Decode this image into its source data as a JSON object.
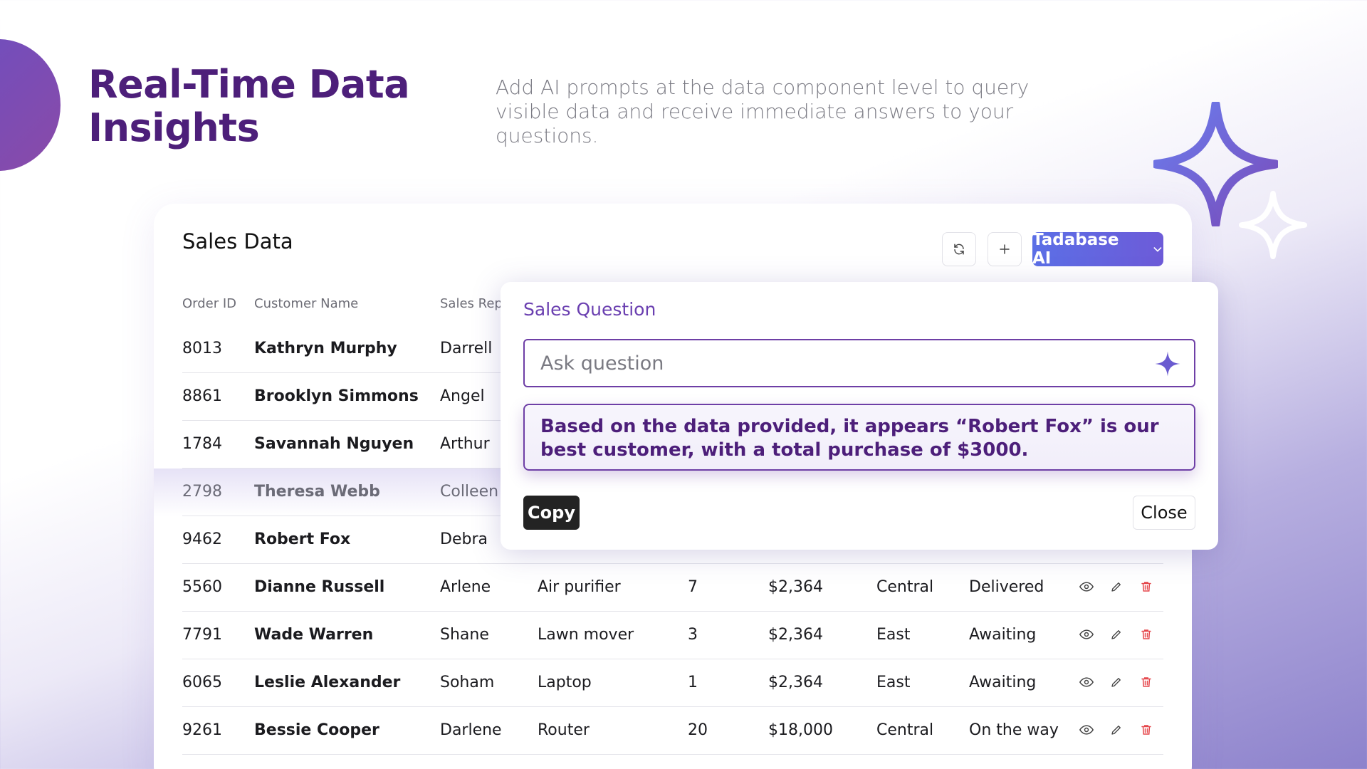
{
  "hero": {
    "title_line1": "Real-Time Data",
    "title_line2": "Insights",
    "description": "Add AI prompts at the data component level to query visible data and receive immediate answers to your questions."
  },
  "card": {
    "title": "Sales Data",
    "refresh_icon": "refresh-icon",
    "add_icon": "plus-icon",
    "ai_button_label": "Tadabase AI",
    "columns": [
      "Order ID",
      "Customer Name",
      "Sales Rep"
    ],
    "rows": [
      {
        "id": "8013",
        "name": "Kathryn Murphy",
        "rep": "Darrell",
        "product": "",
        "qty": "",
        "price": "",
        "region": "",
        "status": ""
      },
      {
        "id": "8861",
        "name": "Brooklyn Simmons",
        "rep": "Angel",
        "product": "",
        "qty": "",
        "price": "",
        "region": "",
        "status": ""
      },
      {
        "id": "1784",
        "name": "Savannah Nguyen",
        "rep": "Arthur",
        "product": "",
        "qty": "",
        "price": "",
        "region": "",
        "status": ""
      },
      {
        "id": "2798",
        "name": "Theresa Webb",
        "rep": "Colleen",
        "product": "",
        "qty": "",
        "price": "",
        "region": "",
        "status": ""
      },
      {
        "id": "9462",
        "name": "Robert Fox",
        "rep": "Debra",
        "product": "",
        "qty": "",
        "price": "",
        "region": "",
        "status": ""
      },
      {
        "id": "5560",
        "name": "Dianne Russell",
        "rep": "Arlene",
        "product": "Air purifier",
        "qty": "7",
        "price": "$2,364",
        "region": "Central",
        "status": "Delivered"
      },
      {
        "id": "7791",
        "name": "Wade Warren",
        "rep": "Shane",
        "product": "Lawn mover",
        "qty": "3",
        "price": "$2,364",
        "region": "East",
        "status": "Awaiting"
      },
      {
        "id": "6065",
        "name": "Leslie Alexander",
        "rep": "Soham",
        "product": "Laptop",
        "qty": "1",
        "price": "$2,364",
        "region": "East",
        "status": "Awaiting"
      },
      {
        "id": "9261",
        "name": "Bessie Cooper",
        "rep": "Darlene",
        "product": "Router",
        "qty": "20",
        "price": "$18,000",
        "region": "Central",
        "status": "On the way"
      }
    ],
    "row_actions": [
      "eye-icon",
      "pencil-icon",
      "trash-icon"
    ]
  },
  "popup": {
    "title": "Sales Question",
    "input_placeholder": "Ask question",
    "answer": "Based on the data provided, it appears “Robert Fox” is our best customer, with a total purchase of $3000.",
    "copy_label": "Copy",
    "close_label": "Close"
  },
  "colors": {
    "brand_purple": "#4d1f7a",
    "accent_blue": "#5b6fe6",
    "delete_red": "#e5484d"
  }
}
